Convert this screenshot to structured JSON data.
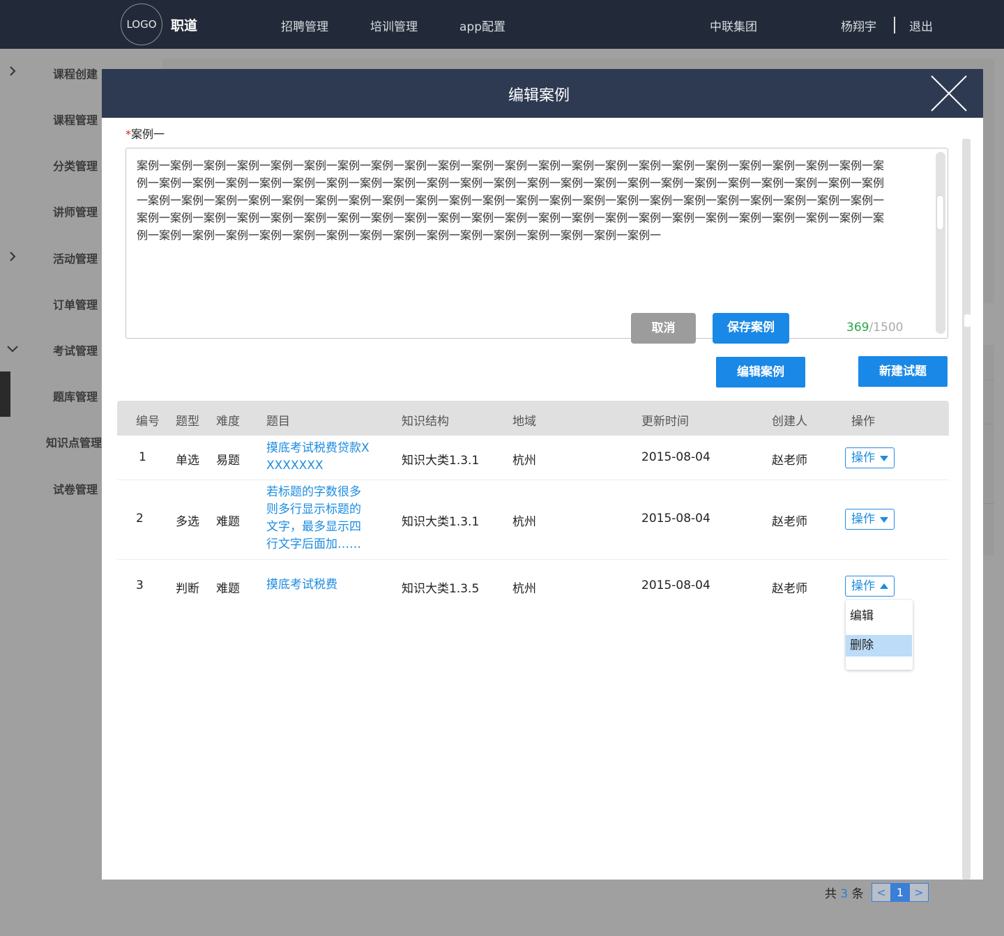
{
  "topbar": {
    "logo": "LOGO",
    "brand": "职道",
    "nav": [
      "招聘管理",
      "培训管理",
      "app配置"
    ],
    "company": "中联集团",
    "user": "杨翔宇",
    "logout": "退出"
  },
  "sidebar": {
    "items": [
      "课程创建",
      "课程管理",
      "分类管理",
      "讲师管理",
      "活动管理",
      "订单管理",
      "考试管理",
      "题库管理",
      "知识点管理",
      "试卷管理"
    ]
  },
  "pagination": {
    "prefix": "共",
    "total": "3",
    "suffix": "条",
    "prev": "<",
    "page": "1",
    "next": ">"
  },
  "modal": {
    "title": "编辑案例",
    "case_label_required": "*",
    "case_label": "案例一",
    "case_text": "案例一案例一案例一案例一案例一案例一案例一案例一案例一案例一案例一案例一案例一案例一案例一案例一案例一案例一案例一案例一案例一案例一案例一案例一案例一案例一案例一案例一案例一案例一案例一案例一案例一案例一案例一案例一案例一案例一案例一案例一案例一案例一案例一案例一案例一案例一案例一案例一案例一案例一案例一案例一案例一案例一案例一案例一案例一案例一案例一案例一案例一案例一案例一案例一案例一案例一案例一案例一案例一案例一案例一案例一案例一案例一案例一案例一案例一案例一案例一案例一案例一案例一案例一案例一案例一案例一案例一案例一案例一案例一案例一案例一案例一案例一案例一案例一案例一案例一案例一案例一案例一案例一案例一案例一案例一",
    "cancel": "取消",
    "save": "保存案例",
    "count_current": "369",
    "count_max": "/1500",
    "edit_case": "编辑案例",
    "new_question": "新建试题"
  },
  "table": {
    "headers": [
      "编号",
      "题型",
      "难度",
      "题目",
      "知识结构",
      "地域",
      "更新时间",
      "创建人",
      "操作"
    ],
    "rows": [
      {
        "no": "1",
        "type": "单选",
        "level": "易题",
        "title": "摸底考试税费贷款XXXXXXXX",
        "knowledge": "知识大类1.3.1",
        "region": "杭州",
        "updated": "2015-08-04",
        "creator": "赵老师",
        "op": "操作"
      },
      {
        "no": "2",
        "type": "多选",
        "level": "难题",
        "title": "若标题的字数很多则多行显示标题的文字，最多显示四行文字后面加……",
        "knowledge": "知识大类1.3.1",
        "region": "杭州",
        "updated": "2015-08-04",
        "creator": "赵老师",
        "op": "操作"
      },
      {
        "no": "3",
        "type": "判断",
        "level": "难题",
        "title": "摸底考试税费",
        "knowledge": "知识大类1.3.5",
        "region": "杭州",
        "updated": "2015-08-04",
        "creator": "赵老师",
        "op": "操作"
      }
    ],
    "dropdown": [
      "编辑",
      "删除"
    ]
  },
  "colors": {
    "header": "#222a39",
    "modal_header": "#2e3a52",
    "primary": "#1a88e6",
    "link": "#1d8ce0",
    "counter": "#27a745"
  }
}
